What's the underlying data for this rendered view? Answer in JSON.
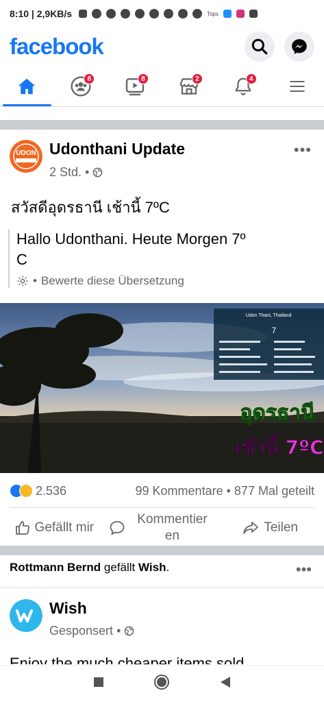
{
  "status_bar": {
    "time": "8:10",
    "network": "2,9KB/s",
    "tops_label": "Tops"
  },
  "app": {
    "logo": "facebook",
    "accent": "#1877f2"
  },
  "nav": {
    "friends_badge": "8",
    "watch_badge": "8",
    "marketplace_badge": "2",
    "notifications_badge": "4"
  },
  "post": {
    "page_name": "Udonthani Update",
    "avatar_text": "UDON",
    "time": "2 Std.",
    "original_text": "สวัสดีอุดรธานี เช้านี้ 7ºC",
    "translation_line1": "Hallo Udonthani. Heute Morgen 7º",
    "translation_line2": "C",
    "rate_translation": "Bewerte diese Übersetzung",
    "photo_overlay": {
      "location": "Udon Thani, Thailand",
      "temp": "7",
      "caption_line1": "อุดรธานี",
      "caption_line2": "เช้านี้ 7ºC"
    },
    "reactions_count": "2.536",
    "comments": "99 Kommentare",
    "shares": "877 Mal geteilt",
    "like_label": "Gefällt mir",
    "comment_label_1": "Kommentier",
    "comment_label_2": "en",
    "share_label": "Teilen"
  },
  "ad": {
    "context_person": "Rottmann Bernd",
    "context_verb": "gefällt",
    "context_page": "Wish",
    "name": "Wish",
    "meta": "Gesponsert",
    "text_preview": "Enjoy the much cheaper items sold"
  }
}
